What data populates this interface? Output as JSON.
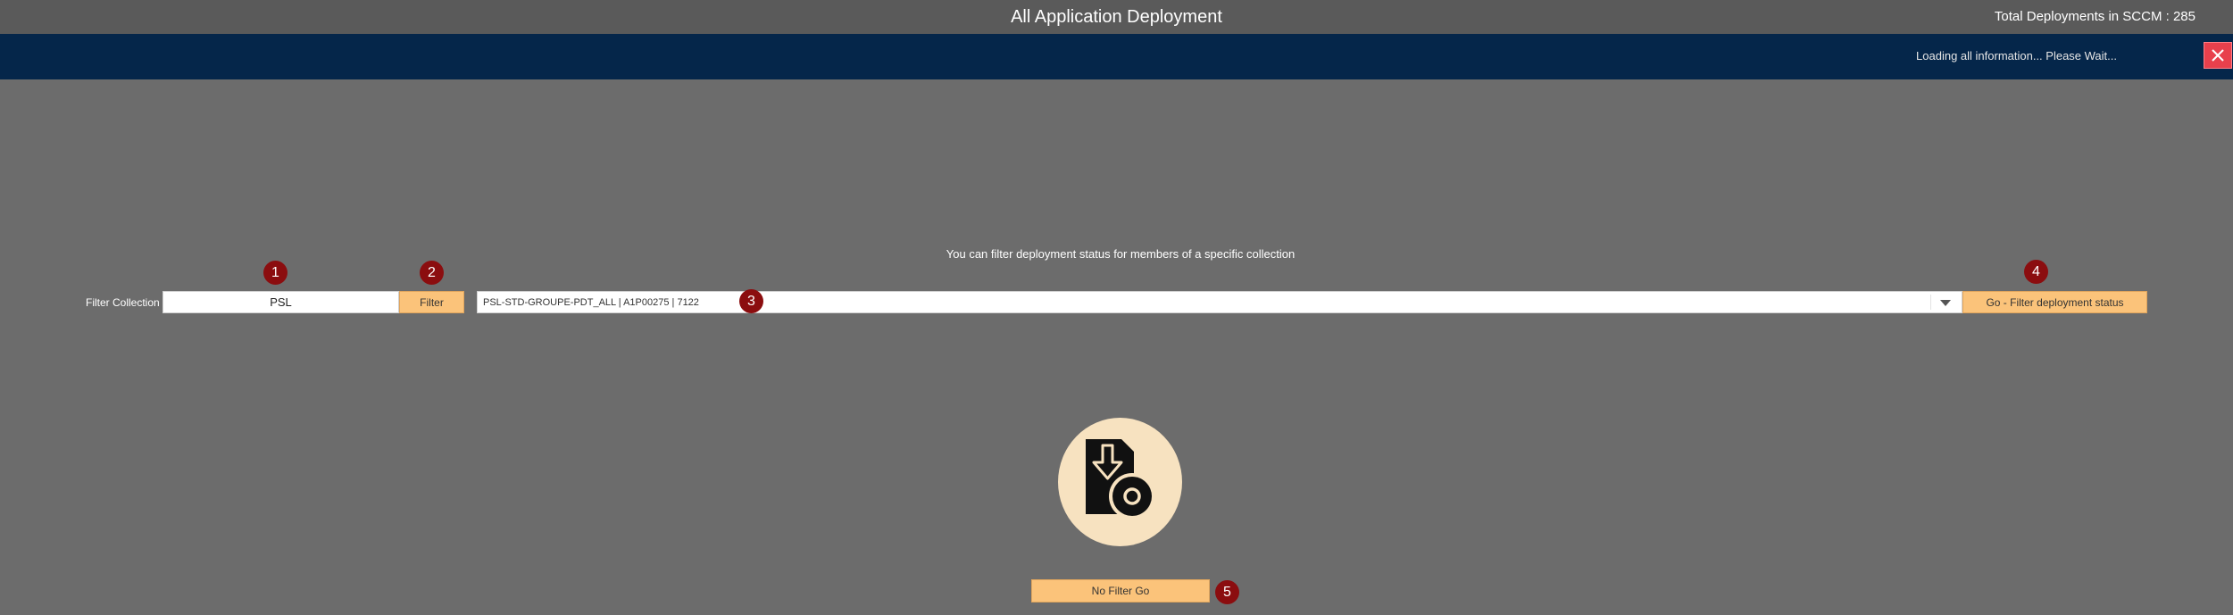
{
  "window": {
    "title": "All Application Deployment",
    "total_deployments": "Total Deployments in SCCM : 285"
  },
  "status": {
    "message": "Loading all information... Please Wait...",
    "close_icon": "close-icon",
    "close_color": "#e8404c",
    "bar_color": "#05264a"
  },
  "filter": {
    "hint": "You can filter deployment status for members of a specific collection",
    "label": "Filter Collection :",
    "input_value": "PSL",
    "filter_button": "Filter",
    "selected_collection": "PSL-STD-GROUPE-PDT_ALL  |  A1P00275  |  7122",
    "go_button": "Go - Filter deployment status",
    "no_filter_button": "No Filter Go",
    "button_color": "#fbc37a"
  },
  "markers": {
    "m1": "1",
    "m2": "2",
    "m3": "3",
    "m4": "4",
    "m5": "5",
    "color": "#8b0d0f"
  },
  "icons": {
    "app_icon": "application-deployment-icon"
  }
}
